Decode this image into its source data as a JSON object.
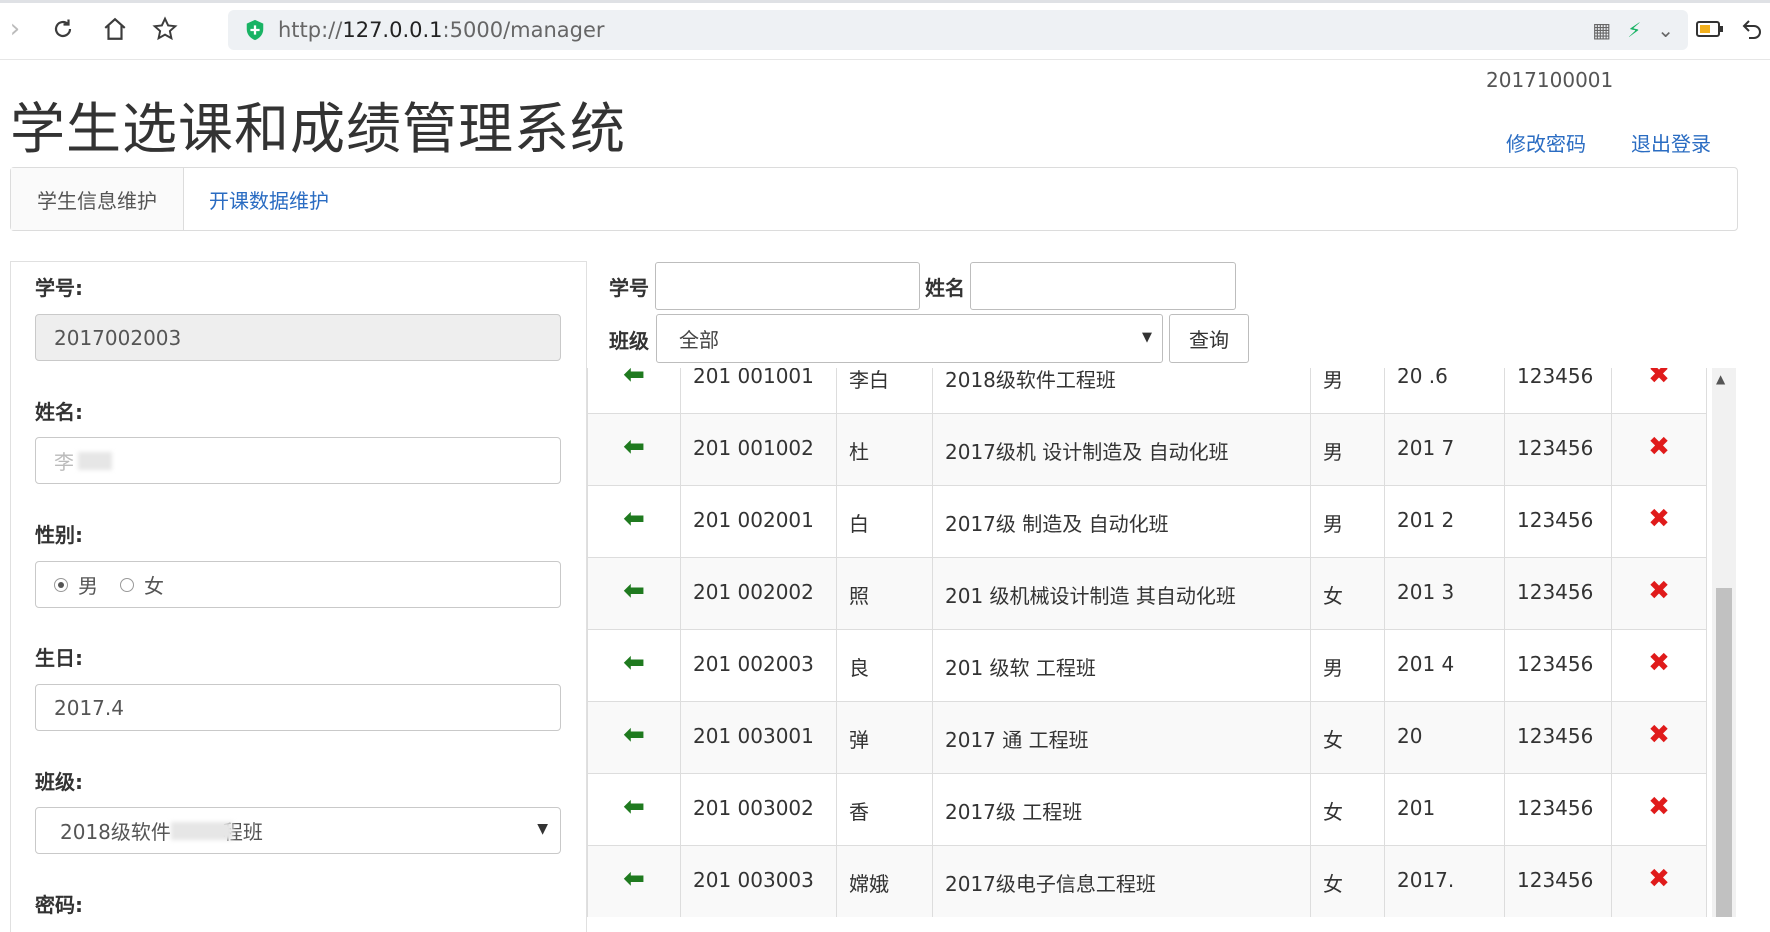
{
  "browser": {
    "url_prefix": "http://",
    "url_host": "127.0.0.1",
    "url_path": ":5000/manager"
  },
  "header": {
    "title": "学生选课和成绩管理系统",
    "user_id": "2017100001",
    "change_password": "修改密码",
    "logout": "退出登录"
  },
  "tabs": [
    {
      "label": "学生信息维护",
      "active": true
    },
    {
      "label": "开课数据维护",
      "active": false
    }
  ],
  "form": {
    "student_no_label": "学号:",
    "student_no_value": "2017002003",
    "name_label": "姓名:",
    "name_value": "李",
    "gender_label": "性别:",
    "gender_male": "男",
    "gender_female": "女",
    "gender_selected": "男",
    "birthday_label": "生日:",
    "birthday_value": "2017.4",
    "class_label": "班级:",
    "class_value": "2018级软件",
    "password_label": "密码:"
  },
  "search": {
    "student_no_label": "学号",
    "name_label": "姓名",
    "class_label": "班级",
    "class_selected": "全部",
    "query_button": "查询"
  },
  "table": {
    "rows": [
      {
        "no": "201 001001",
        "name": "李白",
        "class": "2018级软件工程班",
        "gender": "男",
        "birthday": "20 .6",
        "password": "123456"
      },
      {
        "no": "201 001002",
        "name": "杜",
        "class": "2017级机 设计制造及 自动化班",
        "gender": "男",
        "birthday": "201 7",
        "password": "123456"
      },
      {
        "no": "201 002001",
        "name": "白",
        "class": "2017级 制造及 自动化班",
        "gender": "男",
        "birthday": "201 2",
        "password": "123456"
      },
      {
        "no": "201 002002",
        "name": "照",
        "class": "201 级机械设计制造 其自动化班",
        "gender": "女",
        "birthday": "201 3",
        "password": "123456"
      },
      {
        "no": "201 002003",
        "name": "良",
        "class": "201 级软 工程班",
        "gender": "男",
        "birthday": "201 4",
        "password": "123456"
      },
      {
        "no": "201 003001",
        "name": "弹",
        "class": "2017 通 工程班",
        "gender": "女",
        "birthday": "20",
        "password": "123456"
      },
      {
        "no": "201 003002",
        "name": "香",
        "class": "2017级 工程班",
        "gender": "女",
        "birthday": "201",
        "password": "123456"
      },
      {
        "no": "201 003003",
        "name": "嫦娥",
        "class": "2017级电子信息工程班",
        "gender": "女",
        "birthday": "2017.",
        "password": "123456"
      }
    ]
  },
  "icons": {
    "row_select": "arrow-left-icon",
    "row_delete": "delete-x-icon",
    "arrow_color": "#1f7a1f",
    "delete_color": "#e01b1b",
    "link_color": "#2a6cc2"
  }
}
